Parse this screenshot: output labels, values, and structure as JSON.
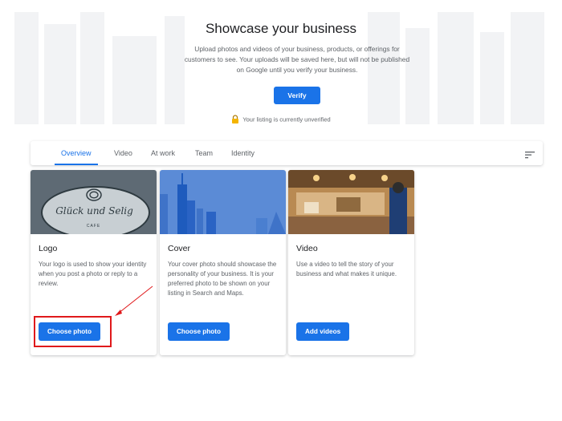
{
  "hero": {
    "title": "Showcase your business",
    "description": "Upload photos and videos of your business, products, or offerings for customers to see. Your uploads will be saved here, but will not be published on Google until you verify your business.",
    "verify_label": "Verify",
    "status_text": "Your listing is currently unverified"
  },
  "tabs": [
    {
      "label": "Overview",
      "active": true
    },
    {
      "label": "Video",
      "active": false
    },
    {
      "label": "At work",
      "active": false
    },
    {
      "label": "Team",
      "active": false
    },
    {
      "label": "Identity",
      "active": false
    }
  ],
  "cards": [
    {
      "title": "Logo",
      "description": "Your logo is used to show your identity when you post a photo or reply to a review.",
      "button_label": "Choose photo",
      "logo_script": "Glück und Selig",
      "logo_subtext": "CAFE"
    },
    {
      "title": "Cover",
      "description": "Your cover photo should showcase the personality of your business. It is your preferred photo to be shown on your listing in Search and Maps.",
      "button_label": "Choose photo"
    },
    {
      "title": "Video",
      "description": "Use a video to tell the story of your business and what makes it unique.",
      "button_label": "Add videos"
    }
  ],
  "icons": {
    "status": "lock-icon",
    "sort": "sort-icon"
  },
  "colors": {
    "accent": "#1a73e8",
    "annotation": "#e0191b",
    "lock": "#f4b400"
  }
}
